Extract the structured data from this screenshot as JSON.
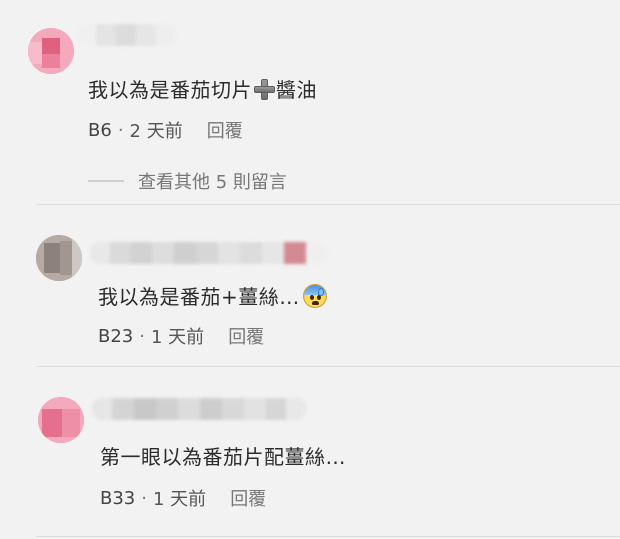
{
  "comments": [
    {
      "text_before_icon": "我以為是番茄切片",
      "icon": "heavy-plus-icon",
      "text_after_icon": "醬油",
      "floor": "B6",
      "separator": "·",
      "time": "2 天前",
      "reply_label": "回覆",
      "more_replies": "查看其他 5 則留言"
    },
    {
      "text": "我以為是番茄+薑絲…",
      "icon": "anxious-sweat-face-icon",
      "floor": "B23",
      "separator": "·",
      "time": "1 天前",
      "reply_label": "回覆"
    },
    {
      "text": "第一眼以為番茄片配薑絲…",
      "floor": "B33",
      "separator": "·",
      "time": "1 天前",
      "reply_label": "回覆"
    }
  ]
}
